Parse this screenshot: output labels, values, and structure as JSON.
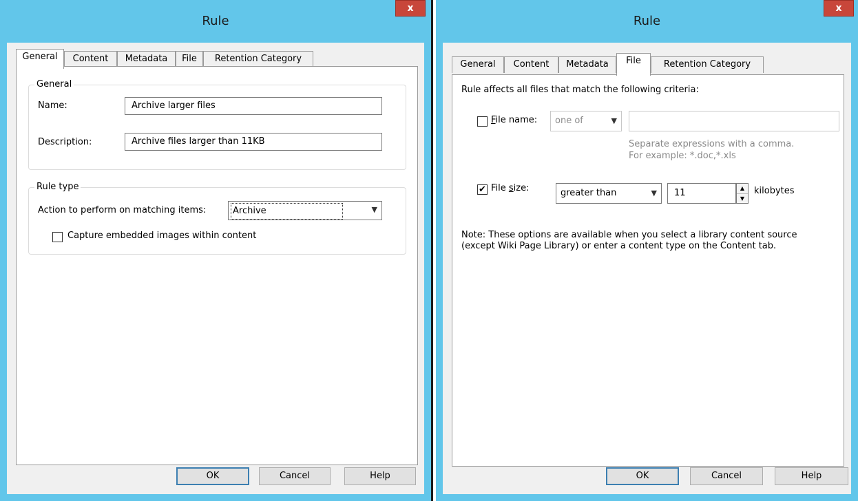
{
  "left_dialog": {
    "title": "Rule",
    "close": "x",
    "tabs": [
      "General",
      "Content",
      "Metadata",
      "File",
      "Retention Category"
    ],
    "active_tab": "General",
    "general_group": {
      "legend": "General",
      "name_label": "Name:",
      "name_value": "Archive larger files",
      "description_label": "Description:",
      "description_value": "Archive files larger than 11KB"
    },
    "rule_type_group": {
      "legend": "Rule type",
      "action_label": "Action to perform on matching items:",
      "action_value": "Archive",
      "capture_images_label": "Capture embedded images within content",
      "capture_images_checked": false
    },
    "buttons": {
      "ok": "OK",
      "cancel": "Cancel",
      "help": "Help"
    }
  },
  "right_dialog": {
    "title": "Rule",
    "close": "x",
    "tabs": [
      "General",
      "Content",
      "Metadata",
      "File",
      "Retention Category"
    ],
    "active_tab": "File",
    "intro": "Rule affects all files that match the following criteria:",
    "file_name": {
      "label": "File name:",
      "checked": false,
      "operator": "one of",
      "value": "",
      "hint_line1": "Separate expressions with a comma.",
      "hint_line2": "For example: *.doc,*.xls"
    },
    "file_size": {
      "label": "File size:",
      "checked": true,
      "check_glyph": "✔",
      "operator": "greater than",
      "value": "11",
      "unit": "kilobytes"
    },
    "note": "Note: These options are available when you select a library content source (except Wiki Page Library) or enter a content type on the Content tab.",
    "buttons": {
      "ok": "OK",
      "cancel": "Cancel",
      "help": "Help"
    }
  },
  "colors": {
    "window_frame": "#62c6ea",
    "close_button": "#c8463a",
    "default_button_border": "#3c7fb1"
  }
}
